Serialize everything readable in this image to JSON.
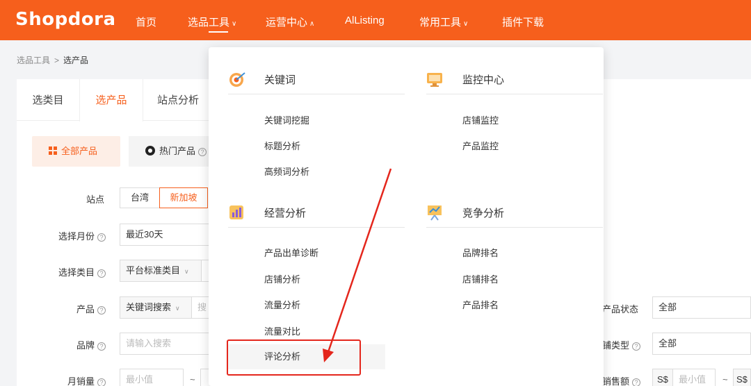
{
  "brand": {
    "logo": "Shopdora",
    "accent": "#f65f1c",
    "annotation_color": "#e4261c"
  },
  "nav": [
    {
      "label": "首页",
      "chevron": ""
    },
    {
      "label": "选品工具",
      "chevron": "∨"
    },
    {
      "label": "运营中心",
      "chevron": "∧"
    },
    {
      "label": "AlListing",
      "chevron": ""
    },
    {
      "label": "常用工具",
      "chevron": "∨"
    },
    {
      "label": "插件下载",
      "chevron": ""
    }
  ],
  "breadcrumb": {
    "parent": "选品工具",
    "separator": ">",
    "current": "选产品"
  },
  "tabs": [
    "选类目",
    "选产品",
    "站点分析"
  ],
  "category_buttons": {
    "all": "全部产品",
    "hot": "热门产品"
  },
  "filters": {
    "site": {
      "label": "站点",
      "options": [
        "台湾",
        "新加坡"
      ],
      "selected": "新加坡"
    },
    "month": {
      "label": "选择月份",
      "value": "最近30天"
    },
    "category": {
      "label": "选择类目",
      "value": "平台标准类目"
    },
    "product": {
      "label": "产品",
      "value": "关键词搜索",
      "input_partial": "搜"
    },
    "brand": {
      "label": "品牌",
      "placeholder": "请输入搜索"
    },
    "monthly_sales": {
      "label": "月销量",
      "min_placeholder": "最小值",
      "separator": "~"
    },
    "product_status": {
      "label": "产品状态",
      "value": "全部"
    },
    "shop_type": {
      "label": "铺类型",
      "value": "全部"
    },
    "sales_amount": {
      "label": "销售额",
      "currency": "S$",
      "min_placeholder": "最小值",
      "separator": "~",
      "currency2": "S$"
    }
  },
  "dropdown": {
    "sections": [
      {
        "title": "关键词",
        "icon": "target-icon",
        "items": [
          "关键词挖掘",
          "标题分析",
          "高频词分析"
        ]
      },
      {
        "title": "监控中心",
        "icon": "monitor-icon",
        "items": [
          "店铺监控",
          "产品监控"
        ]
      },
      {
        "title": "经营分析",
        "icon": "bar-chart-icon",
        "items": [
          "产品出单诊断",
          "店铺分析",
          "流量分析",
          "流量对比",
          "评论分析"
        ]
      },
      {
        "title": "竞争分析",
        "icon": "presentation-icon",
        "items": [
          "品牌排名",
          "店铺排名",
          "产品排名"
        ]
      }
    ],
    "highlighted_item": "评论分析"
  }
}
